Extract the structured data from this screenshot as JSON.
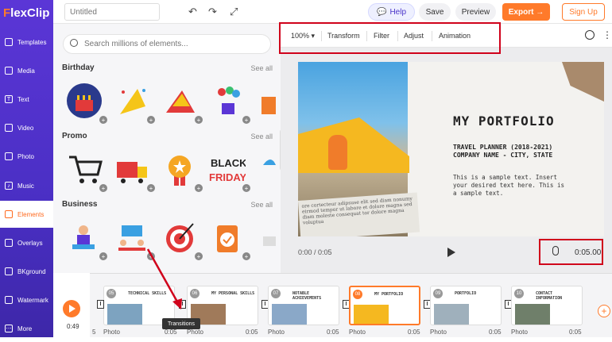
{
  "app": {
    "logo": "FlexClip",
    "title_placeholder": "Untitled"
  },
  "header": {
    "help": "Help",
    "save": "Save",
    "preview": "Preview",
    "export": "Export →",
    "signup": "Sign Up"
  },
  "sidebar": {
    "items": [
      {
        "label": "Templates",
        "icon": "templates-icon"
      },
      {
        "label": "Media",
        "icon": "media-icon"
      },
      {
        "label": "Text",
        "icon": "text-icon"
      },
      {
        "label": "Video",
        "icon": "video-icon"
      },
      {
        "label": "Photo",
        "icon": "photo-icon"
      },
      {
        "label": "Music",
        "icon": "music-icon"
      },
      {
        "label": "Elements",
        "icon": "elements-icon",
        "active": true
      },
      {
        "label": "Overlays",
        "icon": "overlays-icon"
      },
      {
        "label": "BKground",
        "icon": "background-icon"
      },
      {
        "label": "Watermark",
        "icon": "watermark-icon"
      },
      {
        "label": "More",
        "icon": "more-icon"
      }
    ]
  },
  "panel": {
    "search_placeholder": "Search millions of elements...",
    "sections": [
      {
        "title": "Birthday",
        "see_all": "See all"
      },
      {
        "title": "Promo",
        "see_all": "See all"
      },
      {
        "title": "Business",
        "see_all": "See all"
      }
    ]
  },
  "toolbar": {
    "zoom": "100%",
    "transform": "Transform",
    "filter": "Filter",
    "adjust": "Adjust",
    "animation": "Animation"
  },
  "canvas": {
    "title": "MY PORTFOLIO",
    "sub1": "TRAVEL PLANNER (2018-2021)",
    "sub2": "COMPANY NAME - CITY, STATE",
    "body1": "This is a sample text. Insert",
    "body2": "your desired text here. This is",
    "body3": "a sample text.",
    "news": "ore cortecteur adipsuse elit sed diam nonumy eirmod tempor ut labore et dolore magna sed diam moleste consequat tor dolore magna voluptua"
  },
  "player": {
    "current": "0:00 / 0:05",
    "duration": "0:05.00"
  },
  "timeline": {
    "time": "0:49",
    "clips": [
      {
        "num": "05",
        "title": "TECHNICAL SKILLS",
        "label": "Photo",
        "dur": "0:05"
      },
      {
        "num": "06",
        "title": "MY PERSONAL SKILLS",
        "label": "Photo",
        "dur": "0:05"
      },
      {
        "num": "07",
        "title": "NOTABLE ACHIEVEMENTS",
        "label": "Photo",
        "dur": "0:05"
      },
      {
        "num": "08",
        "title": "MY PORTFOLIO",
        "label": "Photo",
        "dur": "0:05"
      },
      {
        "num": "09",
        "title": "PORTFOLIO",
        "label": "Photo",
        "dur": "0:05"
      },
      {
        "num": "10",
        "title": "CONTACT INFORMATION",
        "label": "Photo",
        "dur": "0:05"
      }
    ],
    "tooltip": "Transitions",
    "cut_label": "5"
  },
  "colors": {
    "brand": "#5b36d6",
    "accent": "#ff7a2a",
    "highlight": "#d0021b"
  }
}
